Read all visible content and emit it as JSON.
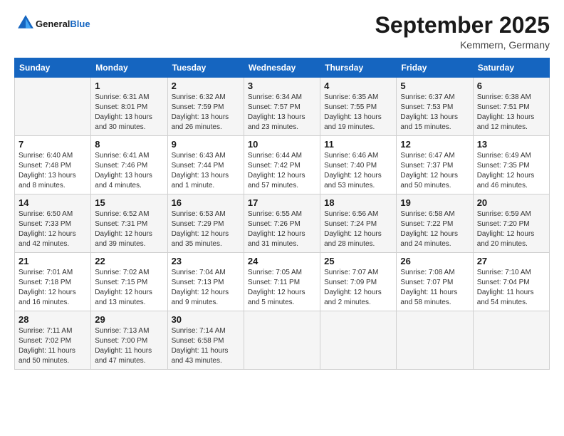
{
  "header": {
    "logo_general": "General",
    "logo_blue": "Blue",
    "month_title": "September 2025",
    "location": "Kemmern, Germany"
  },
  "weekdays": [
    "Sunday",
    "Monday",
    "Tuesday",
    "Wednesday",
    "Thursday",
    "Friday",
    "Saturday"
  ],
  "weeks": [
    [
      {
        "day": "",
        "sunrise": "",
        "sunset": "",
        "daylight": ""
      },
      {
        "day": "1",
        "sunrise": "Sunrise: 6:31 AM",
        "sunset": "Sunset: 8:01 PM",
        "daylight": "Daylight: 13 hours and 30 minutes."
      },
      {
        "day": "2",
        "sunrise": "Sunrise: 6:32 AM",
        "sunset": "Sunset: 7:59 PM",
        "daylight": "Daylight: 13 hours and 26 minutes."
      },
      {
        "day": "3",
        "sunrise": "Sunrise: 6:34 AM",
        "sunset": "Sunset: 7:57 PM",
        "daylight": "Daylight: 13 hours and 23 minutes."
      },
      {
        "day": "4",
        "sunrise": "Sunrise: 6:35 AM",
        "sunset": "Sunset: 7:55 PM",
        "daylight": "Daylight: 13 hours and 19 minutes."
      },
      {
        "day": "5",
        "sunrise": "Sunrise: 6:37 AM",
        "sunset": "Sunset: 7:53 PM",
        "daylight": "Daylight: 13 hours and 15 minutes."
      },
      {
        "day": "6",
        "sunrise": "Sunrise: 6:38 AM",
        "sunset": "Sunset: 7:51 PM",
        "daylight": "Daylight: 13 hours and 12 minutes."
      }
    ],
    [
      {
        "day": "7",
        "sunrise": "Sunrise: 6:40 AM",
        "sunset": "Sunset: 7:48 PM",
        "daylight": "Daylight: 13 hours and 8 minutes."
      },
      {
        "day": "8",
        "sunrise": "Sunrise: 6:41 AM",
        "sunset": "Sunset: 7:46 PM",
        "daylight": "Daylight: 13 hours and 4 minutes."
      },
      {
        "day": "9",
        "sunrise": "Sunrise: 6:43 AM",
        "sunset": "Sunset: 7:44 PM",
        "daylight": "Daylight: 13 hours and 1 minute."
      },
      {
        "day": "10",
        "sunrise": "Sunrise: 6:44 AM",
        "sunset": "Sunset: 7:42 PM",
        "daylight": "Daylight: 12 hours and 57 minutes."
      },
      {
        "day": "11",
        "sunrise": "Sunrise: 6:46 AM",
        "sunset": "Sunset: 7:40 PM",
        "daylight": "Daylight: 12 hours and 53 minutes."
      },
      {
        "day": "12",
        "sunrise": "Sunrise: 6:47 AM",
        "sunset": "Sunset: 7:37 PM",
        "daylight": "Daylight: 12 hours and 50 minutes."
      },
      {
        "day": "13",
        "sunrise": "Sunrise: 6:49 AM",
        "sunset": "Sunset: 7:35 PM",
        "daylight": "Daylight: 12 hours and 46 minutes."
      }
    ],
    [
      {
        "day": "14",
        "sunrise": "Sunrise: 6:50 AM",
        "sunset": "Sunset: 7:33 PM",
        "daylight": "Daylight: 12 hours and 42 minutes."
      },
      {
        "day": "15",
        "sunrise": "Sunrise: 6:52 AM",
        "sunset": "Sunset: 7:31 PM",
        "daylight": "Daylight: 12 hours and 39 minutes."
      },
      {
        "day": "16",
        "sunrise": "Sunrise: 6:53 AM",
        "sunset": "Sunset: 7:29 PM",
        "daylight": "Daylight: 12 hours and 35 minutes."
      },
      {
        "day": "17",
        "sunrise": "Sunrise: 6:55 AM",
        "sunset": "Sunset: 7:26 PM",
        "daylight": "Daylight: 12 hours and 31 minutes."
      },
      {
        "day": "18",
        "sunrise": "Sunrise: 6:56 AM",
        "sunset": "Sunset: 7:24 PM",
        "daylight": "Daylight: 12 hours and 28 minutes."
      },
      {
        "day": "19",
        "sunrise": "Sunrise: 6:58 AM",
        "sunset": "Sunset: 7:22 PM",
        "daylight": "Daylight: 12 hours and 24 minutes."
      },
      {
        "day": "20",
        "sunrise": "Sunrise: 6:59 AM",
        "sunset": "Sunset: 7:20 PM",
        "daylight": "Daylight: 12 hours and 20 minutes."
      }
    ],
    [
      {
        "day": "21",
        "sunrise": "Sunrise: 7:01 AM",
        "sunset": "Sunset: 7:18 PM",
        "daylight": "Daylight: 12 hours and 16 minutes."
      },
      {
        "day": "22",
        "sunrise": "Sunrise: 7:02 AM",
        "sunset": "Sunset: 7:15 PM",
        "daylight": "Daylight: 12 hours and 13 minutes."
      },
      {
        "day": "23",
        "sunrise": "Sunrise: 7:04 AM",
        "sunset": "Sunset: 7:13 PM",
        "daylight": "Daylight: 12 hours and 9 minutes."
      },
      {
        "day": "24",
        "sunrise": "Sunrise: 7:05 AM",
        "sunset": "Sunset: 7:11 PM",
        "daylight": "Daylight: 12 hours and 5 minutes."
      },
      {
        "day": "25",
        "sunrise": "Sunrise: 7:07 AM",
        "sunset": "Sunset: 7:09 PM",
        "daylight": "Daylight: 12 hours and 2 minutes."
      },
      {
        "day": "26",
        "sunrise": "Sunrise: 7:08 AM",
        "sunset": "Sunset: 7:07 PM",
        "daylight": "Daylight: 11 hours and 58 minutes."
      },
      {
        "day": "27",
        "sunrise": "Sunrise: 7:10 AM",
        "sunset": "Sunset: 7:04 PM",
        "daylight": "Daylight: 11 hours and 54 minutes."
      }
    ],
    [
      {
        "day": "28",
        "sunrise": "Sunrise: 7:11 AM",
        "sunset": "Sunset: 7:02 PM",
        "daylight": "Daylight: 11 hours and 50 minutes."
      },
      {
        "day": "29",
        "sunrise": "Sunrise: 7:13 AM",
        "sunset": "Sunset: 7:00 PM",
        "daylight": "Daylight: 11 hours and 47 minutes."
      },
      {
        "day": "30",
        "sunrise": "Sunrise: 7:14 AM",
        "sunset": "Sunset: 6:58 PM",
        "daylight": "Daylight: 11 hours and 43 minutes."
      },
      {
        "day": "",
        "sunrise": "",
        "sunset": "",
        "daylight": ""
      },
      {
        "day": "",
        "sunrise": "",
        "sunset": "",
        "daylight": ""
      },
      {
        "day": "",
        "sunrise": "",
        "sunset": "",
        "daylight": ""
      },
      {
        "day": "",
        "sunrise": "",
        "sunset": "",
        "daylight": ""
      }
    ]
  ]
}
